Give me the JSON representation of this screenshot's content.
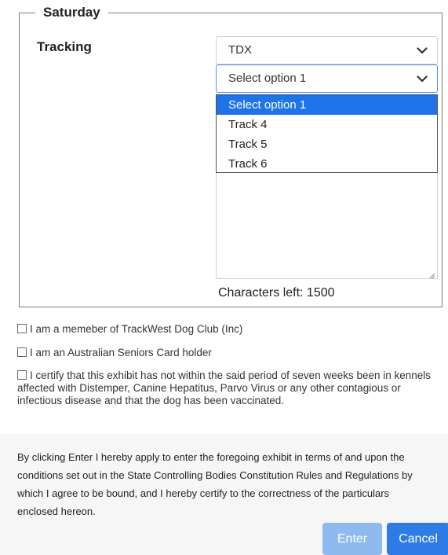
{
  "section": {
    "legend": "Saturday",
    "tracking_label": "Tracking"
  },
  "selects": {
    "class_value": "TDX",
    "option_value": "Select option 1"
  },
  "dropdown": {
    "options": [
      "Select option 1",
      "Track 4",
      "Track 5",
      "Track 6"
    ]
  },
  "textarea": {
    "chars_left": "Characters left: 1500"
  },
  "checkboxes": {
    "member": "I am a memeber of TrackWest Dog Club (Inc)",
    "seniors": "I am an Australian Seniors Card holder",
    "certify": "I certify that this exhibit has not within the said period of seven weeks been in kennels affected with Distemper, Canine Hepatitus, Parvo Virus or any other contagious or infectious disease and that the dog has been vaccinated."
  },
  "notice": {
    "text": "By clicking Enter I hereby apply to enter the foregoing exhibit in terms of and upon the conditions set out in the State Controlling Bodies Constitution Rules and Regulations by which I agree to be bound, and I hereby certify to the correctness of the particulars enclosed hereon."
  },
  "buttons": {
    "enter": "Enter",
    "cancel": "Cancel"
  },
  "colors": {
    "accent": "#1e73e8",
    "enter_disabled": "#8fbaf0",
    "cancel": "#2f7be5"
  }
}
